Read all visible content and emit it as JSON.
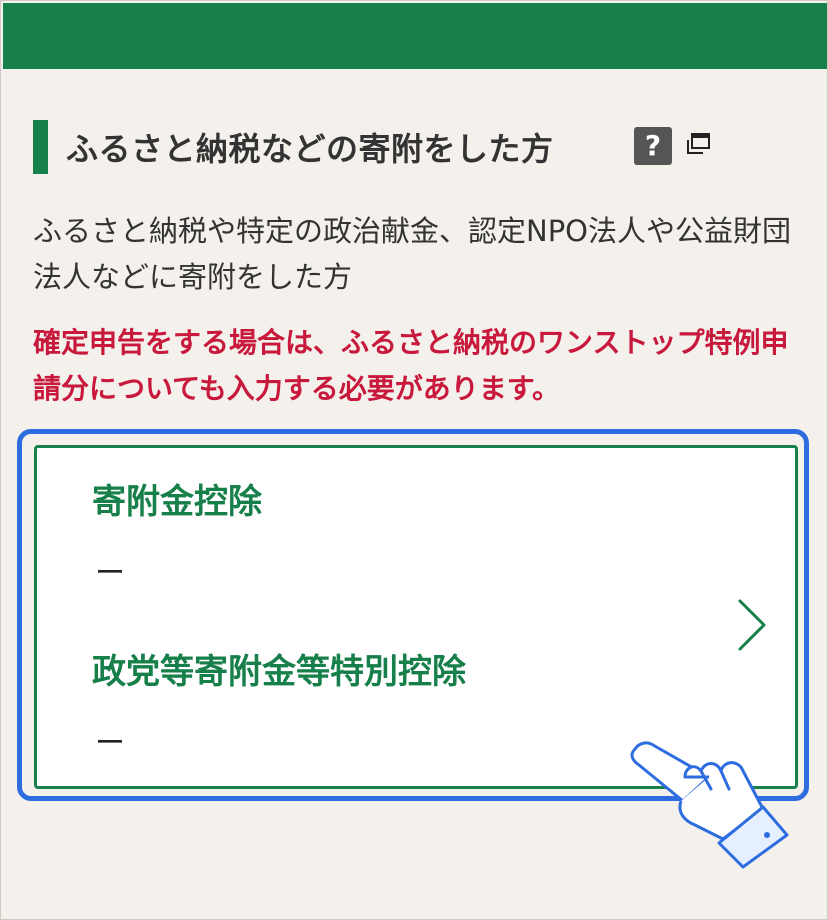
{
  "section": {
    "title": "ふるさと納税などの寄附をした方",
    "help_label": "?",
    "description": "ふるさと納税や特定の政治献金、認定NPO法人や公益財団法人などに寄附をした方",
    "notice": "確定申告をする場合は、ふるさと納税のワンストップ特例申請分についても入力する必要があります。"
  },
  "card": {
    "items": [
      {
        "label": "寄附金控除",
        "value": "ー"
      },
      {
        "label": "政党等寄附金等特別控除",
        "value": "ー"
      }
    ]
  },
  "icons": {
    "help": "question-icon",
    "new_window": "new-window-icon",
    "chevron": "chevron-right-icon",
    "hand": "pointing-hand-icon"
  },
  "colors": {
    "brand_green": "#17804a",
    "notice_red": "#c8193c",
    "focus_blue": "#2e6de0",
    "background": "#f4f1ec"
  }
}
